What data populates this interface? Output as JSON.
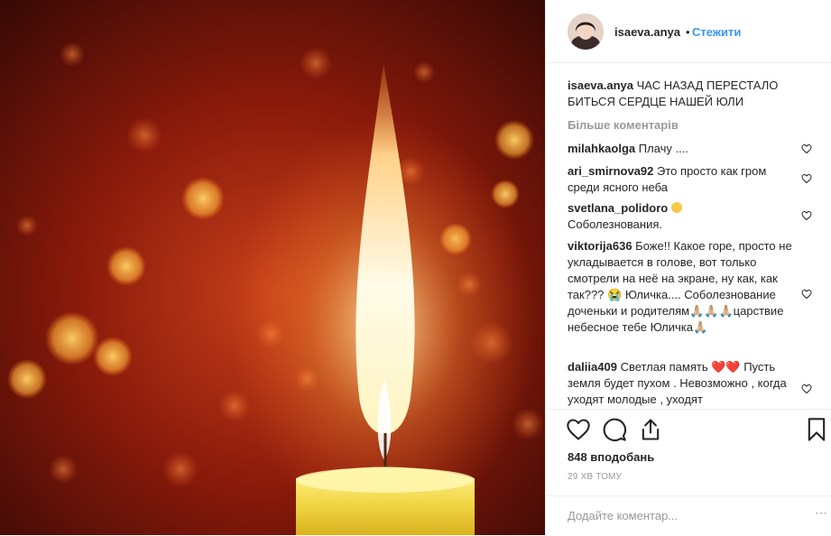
{
  "post": {
    "username": "isaeva.anya",
    "dot": "•",
    "follow_label": "Стежити"
  },
  "caption": {
    "username": "isaeva.anya",
    "text": "ЧАС НАЗАД ПЕРЕСТАЛО БИТЬСЯ СЕРДЦЕ НАШЕЙ ЮЛИ"
  },
  "more_comments_label": "Більше коментарів",
  "comments": [
    {
      "username": "milahkaolga",
      "text": "Плачу ...."
    },
    {
      "username": "ari_smirnova92",
      "text": "Это просто как гром среди ясного неба"
    },
    {
      "username": "svetlana_polidoro",
      "emoji": "😢",
      "text": "Соболезнования."
    },
    {
      "username": "viktorija636",
      "text": "Боже!! Какое горе, просто не укладывается в голове, вот только смотрели на неё на экране, ну как, как так??? 😭 Юличка.... Соболезнование доченьки и родителям🙏🏼🙏🏼🙏🏼царствие небесное тебе Юличка🙏🏼"
    },
    {
      "username": "daliia409",
      "text": "Светлая память ❤️❤️ Пусть земля будет пухом . Невозможно , когда уходят молодые , уходят"
    }
  ],
  "likes_label": "848 вподобань",
  "time_label": "29 ХВ ТОМУ",
  "add_comment": {
    "placeholder": "Додайте коментар..."
  },
  "icons": {
    "like": "heart-outline-icon",
    "comment": "speech-bubble-icon",
    "share": "share-icon",
    "save": "bookmark-icon",
    "comment_like": "small-heart-icon",
    "more_options": "ellipsis-icon"
  },
  "colors": {
    "link": "#3897f0",
    "muted": "#999999",
    "text": "#262626",
    "border": "#efefef"
  }
}
